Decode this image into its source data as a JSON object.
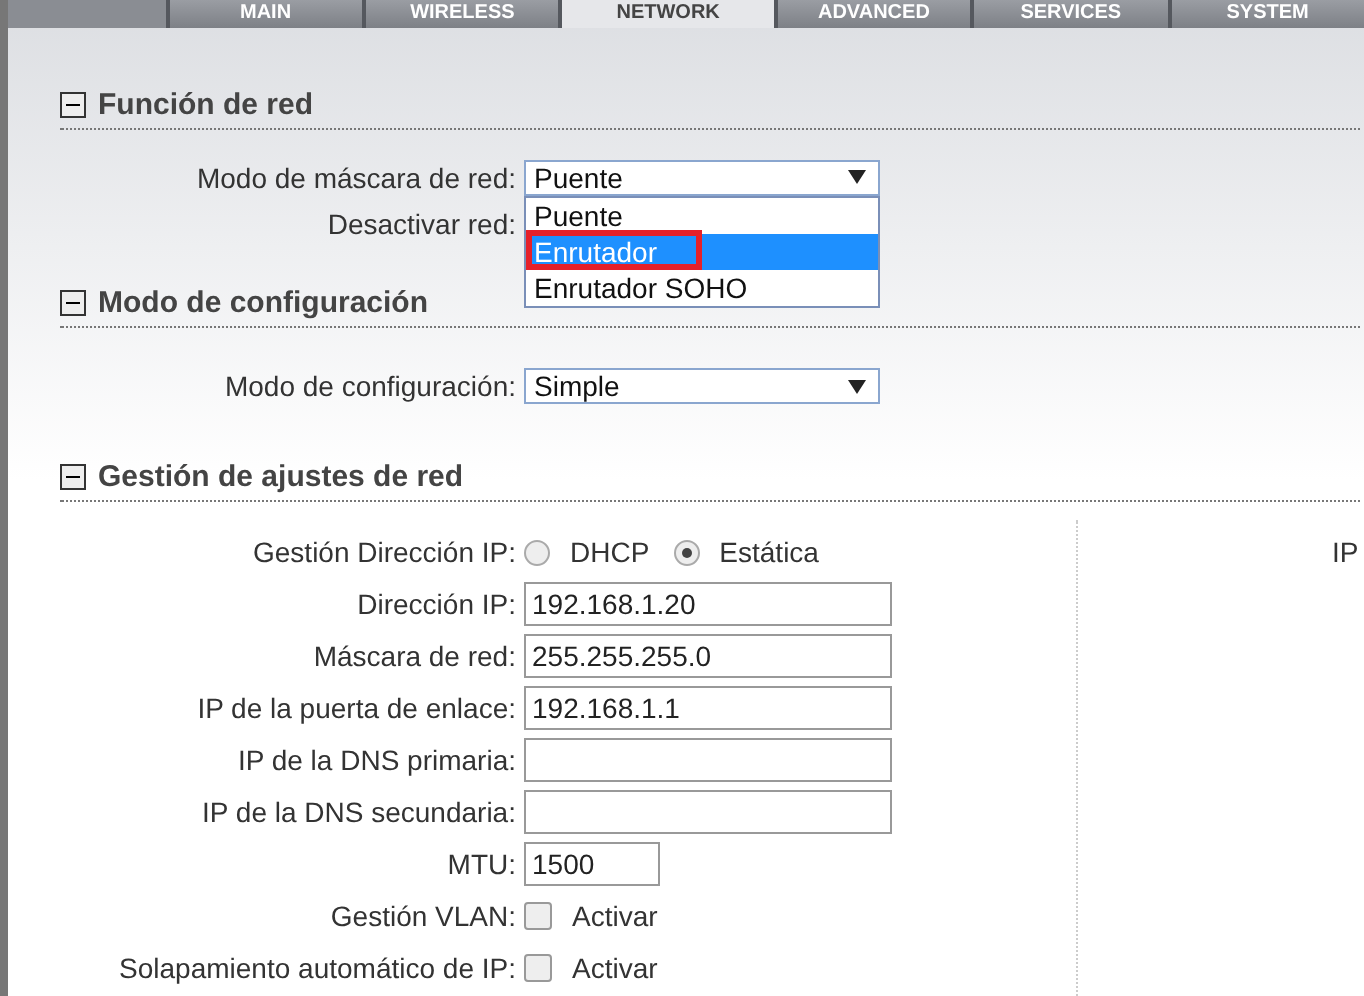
{
  "tabs": [
    {
      "label": "MAIN",
      "selected": false
    },
    {
      "label": "WIRELESS",
      "selected": false
    },
    {
      "label": "NETWORK",
      "selected": true
    },
    {
      "label": "ADVANCED",
      "selected": false
    },
    {
      "label": "SERVICES",
      "selected": false
    },
    {
      "label": "SYSTEM",
      "selected": false
    }
  ],
  "sections": [
    {
      "title": "Función de red",
      "expanded": true,
      "rows": [
        {
          "kind": "select",
          "label": "Modo de máscara de red:",
          "value": "Puente",
          "open": true,
          "options": [
            {
              "label": "Puente",
              "highlighted": false,
              "annotated": false
            },
            {
              "label": "Enrutador",
              "highlighted": true,
              "annotated": true
            },
            {
              "label": "Enrutador SOHO",
              "highlighted": false,
              "annotated": false
            }
          ]
        },
        {
          "kind": "blank",
          "label": "Desactivar red:"
        }
      ]
    },
    {
      "title": "Modo de configuración",
      "expanded": true,
      "rows": [
        {
          "kind": "select",
          "label": "Modo de configuración:",
          "value": "Simple",
          "open": false
        }
      ]
    },
    {
      "title": "Gestión de ajustes de red",
      "expanded": true,
      "side_label": "IP",
      "rows": [
        {
          "kind": "radio",
          "label": "Gestión Dirección IP:",
          "options": [
            {
              "label": "DHCP",
              "selected": false
            },
            {
              "label": "Estática",
              "selected": true
            }
          ]
        },
        {
          "kind": "text",
          "label": "Dirección IP:",
          "value": "192.168.1.20"
        },
        {
          "kind": "text",
          "label": "Máscara de red:",
          "value": "255.255.255.0"
        },
        {
          "kind": "text",
          "label": "IP de la puerta de enlace:",
          "value": "192.168.1.1"
        },
        {
          "kind": "text",
          "label": "IP de la DNS primaria:",
          "value": ""
        },
        {
          "kind": "text",
          "label": "IP de la DNS secundaria:",
          "value": ""
        },
        {
          "kind": "short",
          "label": "MTU:",
          "value": "1500"
        },
        {
          "kind": "checkbox",
          "label": "Gestión VLAN:",
          "text": "Activar",
          "checked": false
        },
        {
          "kind": "checkbox",
          "label": "Solapamiento automático de IP:",
          "text": "Activar",
          "checked": false
        }
      ]
    }
  ]
}
